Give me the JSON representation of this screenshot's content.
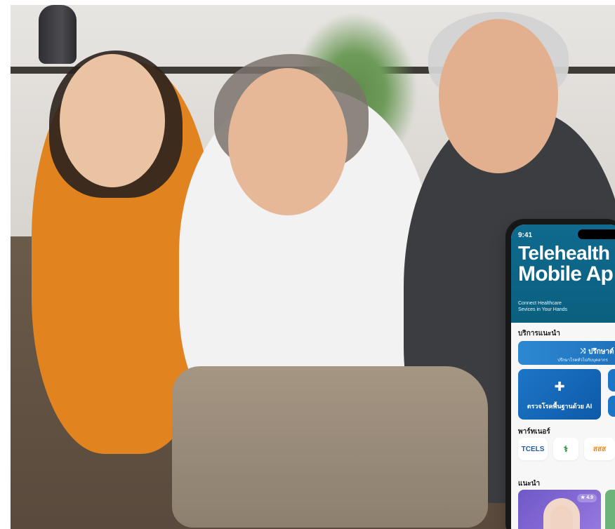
{
  "phone": {
    "status_time": "9:41",
    "hero": {
      "title_line1": "Telehealth",
      "title_line2": "Mobile Ap",
      "subtitle_line1": "Connect Healthcare",
      "subtitle_line2": "Sevices in Your Hands"
    },
    "sections": {
      "recommended_services": "บริการแนะนำ",
      "partners": "พาร์ทเนอร์",
      "recommended": "แนะนำ"
    },
    "cards": {
      "wide_title": "ปรึกษาต์",
      "wide_subtitle": "ปรึกษาโรคทั่วไปกับบุคลากร",
      "ai_screening_label": "ตรวจโรคพื้นฐานด้วย AI"
    },
    "partners": {
      "p1": "TCELS",
      "p2": "⚕",
      "p3": "สสส"
    },
    "rating": "★ 4.9"
  },
  "colors": {
    "hero_bg": "#0f6a8e",
    "service_blue": "#1d75c6",
    "partner_text_blue": "#1f5aa8",
    "partner_text_green": "#2f8f3d",
    "partner_text_orange": "#f28a1a"
  },
  "icons": {
    "wide_card_icon": "shuffle-icon",
    "ai_tile_icon": "medical-cross-icon",
    "rating_icon": "star-icon"
  }
}
